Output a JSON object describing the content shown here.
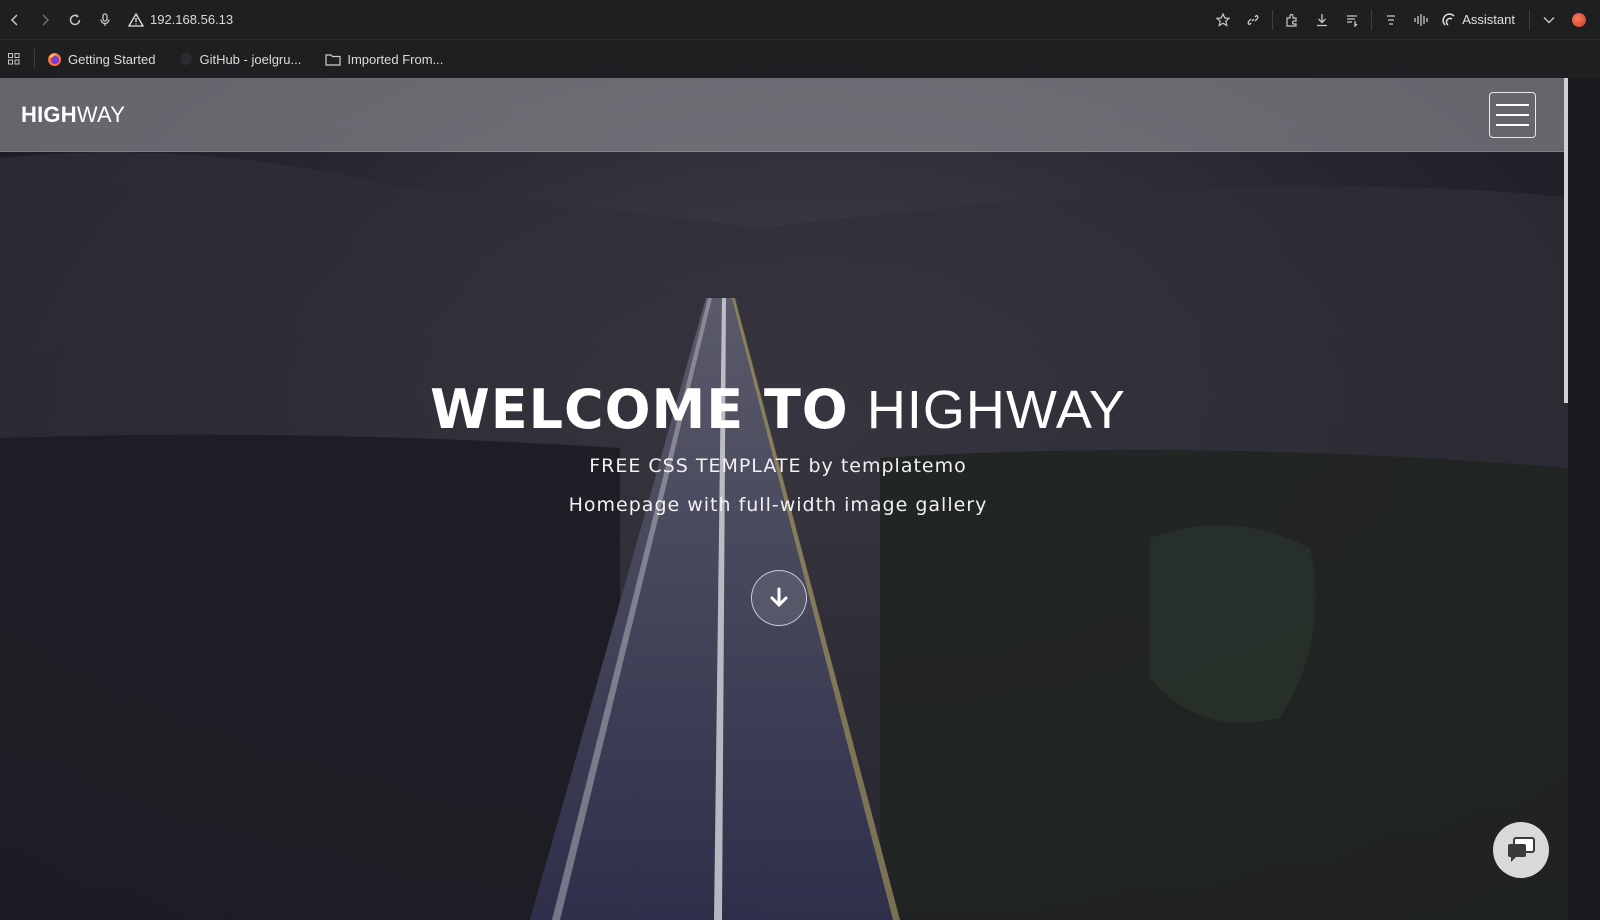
{
  "browser": {
    "url": "192.168.56.13",
    "assistant_label": "Assistant",
    "bookmarks": [
      {
        "label": "Getting Started"
      },
      {
        "label": "GitHub - joelgru..."
      },
      {
        "label": "Imported From..."
      }
    ]
  },
  "site": {
    "logo_bold": "HIGH",
    "logo_light": "WAY",
    "hero": {
      "title_bold": "WELCOME TO",
      "title_light": "HIGHWAY",
      "subtitle_1": "FREE CSS TEMPLATE by templatemo",
      "subtitle_2": "Homepage with full-width image gallery"
    }
  },
  "colors": {
    "chrome": "#1d1f21",
    "nav_overlay": "#a0a0a5",
    "text": "#ffffff"
  },
  "icons": [
    "back-icon",
    "forward-icon",
    "reload-icon",
    "mic-icon",
    "warning-icon",
    "star-icon",
    "link-icon",
    "extensions-icon",
    "download-icon",
    "reading-list-icon",
    "menu-icon",
    "audio-icon",
    "assistant-icon",
    "chevron-down-icon",
    "apps-icon",
    "firefox-icon",
    "github-icon",
    "folder-icon",
    "hamburger-icon",
    "arrow-down-icon",
    "chat-icon"
  ]
}
